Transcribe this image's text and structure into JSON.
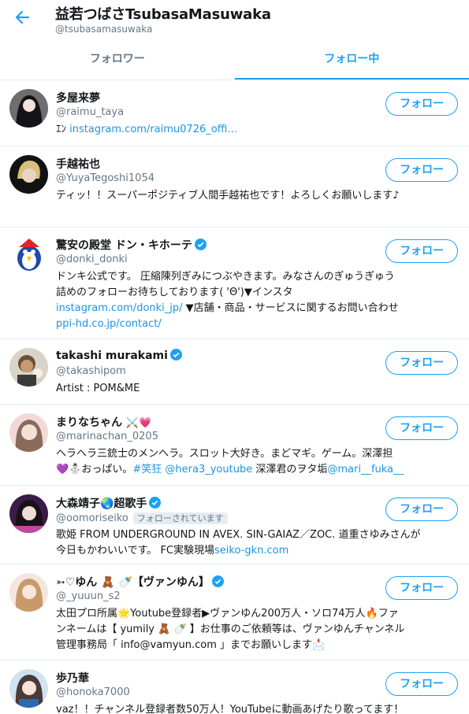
{
  "header": {
    "title": "益若つばさTsubasaMasuwaka",
    "handle": "@tsubasamasuwaka"
  },
  "tabs": {
    "followers": "フォロワー",
    "following": "フォロー中"
  },
  "follow_label": "フォロー",
  "followed_by_label": "フォローされています",
  "colors": {
    "accent": "#1da1f2",
    "link": "#1b95e0",
    "secondary_text": "#657786"
  },
  "users": [
    {
      "name": "多屋来夢",
      "handle": "@raimu_taya",
      "bio_prefix": "ｴﾝ ",
      "bio_link": "instagram.com/raimu0726_offi…"
    },
    {
      "name": "手越祐也",
      "handle": "@YuyaTegoshi1054",
      "bio": "ティッ！！スーパーポジティブ人間手越祐也です！よろしくお願いします♪"
    },
    {
      "name": "驚安の殿堂 ドン・キホーテ",
      "handle": "@donki_donki",
      "bio_line1": "ドンキ公式です。 圧縮陳列ぎみにつぶやきます。みなさんのぎゅうぎゅう",
      "bio_line2": "詰めのフォローお待ちしております( 'Θ')▼インスタ",
      "bio_link1": "instagram.com/donki_jp/",
      "bio_line3": " ▼店舗・商品・サービスに関するお問い合わせ",
      "bio_link2": "ppi-hd.co.jp/contact/"
    },
    {
      "name": "takashi murakami",
      "handle": "@takashipom",
      "bio": "Artist : POM&ME"
    },
    {
      "name": "まりなちゃん",
      "handle": "@marinachan_0205",
      "bio_line1": "ヘラヘラ三銃士のメンヘラ。スロット大好き。まどマギ。ゲーム。深澤担",
      "bio_line2a": "💜⛄おっぱい。",
      "bio_tag": "#笑狂",
      "bio_mention1": " @hera3_youtube",
      "bio_line2b": " 深澤君のヲタ垢",
      "bio_mention2": "@mari__fuka__"
    },
    {
      "name": "大森靖子🌏超歌手",
      "handle": "@oomoriseiko",
      "bio_line1": "歌姫 FROM UNDERGROUND IN AVEX. SIN-GAIAZ／ZOC. 道重さゆみさんが",
      "bio_line2": "今日もかわいいです。 FC実験現場",
      "bio_link": "seiko-gkn.com"
    },
    {
      "name": "➳♡ゆん 🧸 🍼【ヴァンゆん】",
      "handle": "@_yuuun_s2",
      "bio_line1": "太田プロ所属🌟Youtube登録者▶ヴァンゆん200万人・ソロ74万人🔥ファ",
      "bio_line2": "ンネームは【 yumily 🧸 🍼 】お仕事のご依頼等は、ヴァンゆんチャンネル",
      "bio_line3": "管理事務局「 info@vamyun.com 」までお願いします📩"
    },
    {
      "name": "歩乃華",
      "handle": "@honoka7000",
      "bio": "vaz！！チャンネル登録者数50万人！YouTubeに動画あげたり歌ってます！"
    }
  ]
}
